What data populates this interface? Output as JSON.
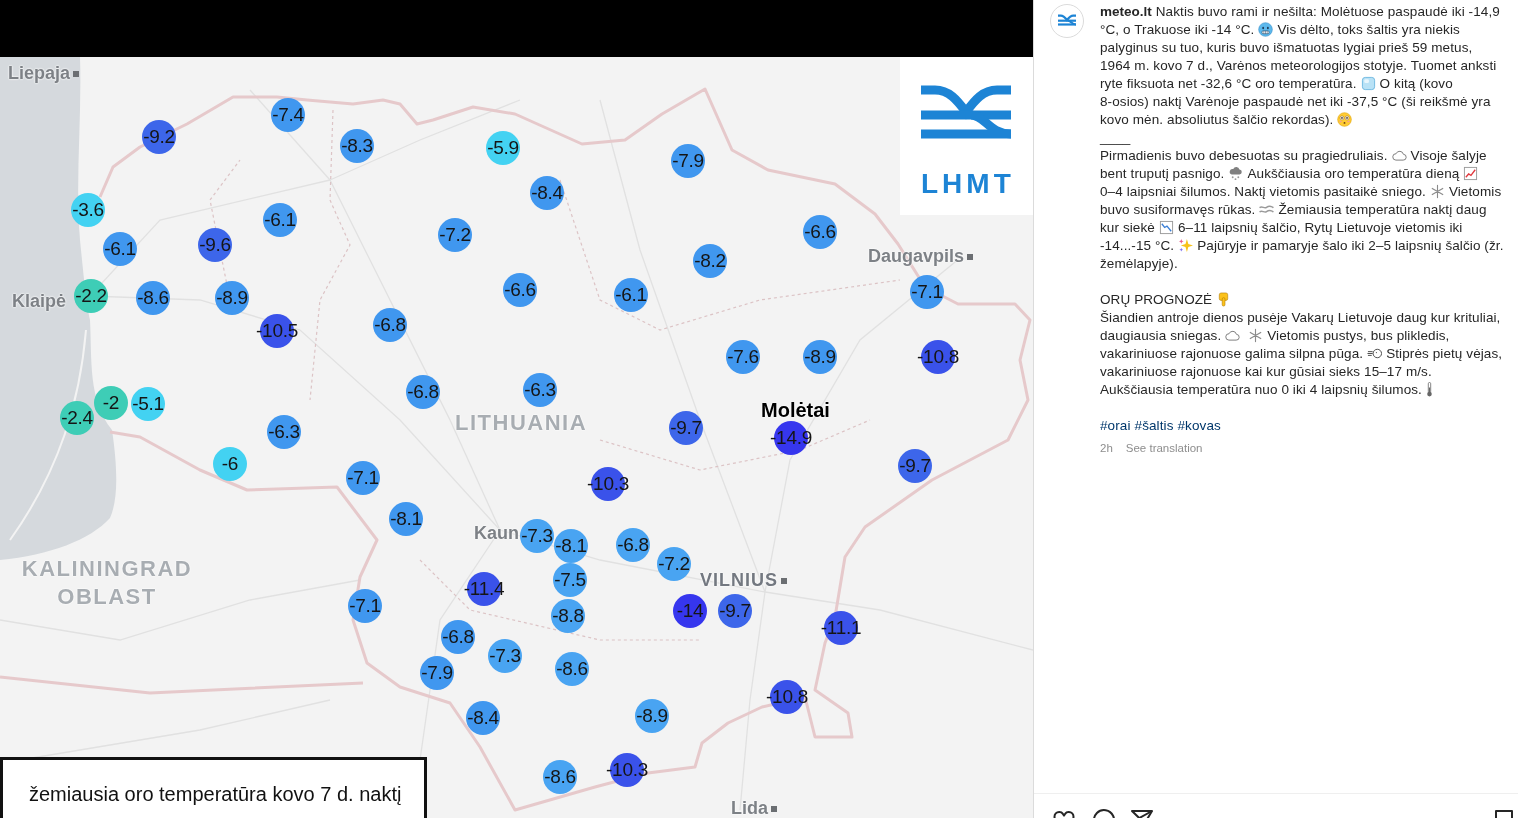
{
  "image": {
    "logo": {
      "text": "LHMT"
    },
    "labels": [
      {
        "kind": "city",
        "text": "Liepaja",
        "square": true
      },
      {
        "kind": "city",
        "text": "Klaipė",
        "square": false
      },
      {
        "kind": "city",
        "text": "Daugavpils",
        "square": true
      },
      {
        "kind": "country",
        "text": "LITHUANIA",
        "square": false
      },
      {
        "kind": "town",
        "text": "Molėtai",
        "square": false
      },
      {
        "kind": "country",
        "text": "KALININGRAD OBLAST",
        "square": false
      },
      {
        "kind": "city",
        "text": "Kaun",
        "square": false
      },
      {
        "kind": "capital",
        "text": "VILNIUS",
        "square": true
      },
      {
        "kind": "city",
        "text": "Lida",
        "square": true
      }
    ],
    "markers": [
      {
        "value": "-7.4",
        "color": "#4097ef"
      },
      {
        "value": "-9.2",
        "color": "#3d66ea"
      },
      {
        "value": "-8.3",
        "color": "#4097ef"
      },
      {
        "value": "-5.9",
        "color": "#43d2f2"
      },
      {
        "value": "-7.9",
        "color": "#4097ef"
      },
      {
        "value": "-8.4",
        "color": "#4097ef"
      },
      {
        "value": "-3.6",
        "color": "#43d2f2"
      },
      {
        "value": "-6.1",
        "color": "#4097ef"
      },
      {
        "value": "-9.6",
        "color": "#3d66ea"
      },
      {
        "value": "-6.1",
        "color": "#4097ef"
      },
      {
        "value": "-7.2",
        "color": "#4097ef"
      },
      {
        "value": "-6.6",
        "color": "#4097ef"
      },
      {
        "value": "-8.2",
        "color": "#4097ef"
      },
      {
        "value": "-2.2",
        "color": "#3ecdb6"
      },
      {
        "value": "-8.6",
        "color": "#4097ef"
      },
      {
        "value": "-8.9",
        "color": "#4097ef"
      },
      {
        "value": "-6.6",
        "color": "#4097ef"
      },
      {
        "value": "-6.1",
        "color": "#4097ef"
      },
      {
        "value": "-7.1",
        "color": "#4097ef"
      },
      {
        "value": "-10.5",
        "color": "#3a52ea"
      },
      {
        "value": "-6.8",
        "color": "#4097ef"
      },
      {
        "value": "-7.6",
        "color": "#4097ef"
      },
      {
        "value": "-8.9",
        "color": "#4097ef"
      },
      {
        "value": "-10.8",
        "color": "#3a52ea"
      },
      {
        "value": "-6.8",
        "color": "#4097ef"
      },
      {
        "value": "-6.3",
        "color": "#4097ef"
      },
      {
        "value": "-2.4",
        "color": "#3ecdb6"
      },
      {
        "value": "-2",
        "color": "#3ecdb6"
      },
      {
        "value": "-5.1",
        "color": "#43d2f2"
      },
      {
        "value": "-6.3",
        "color": "#4097ef"
      },
      {
        "value": "-9.7",
        "color": "#3d66ea"
      },
      {
        "value": "-14.9",
        "color": "#3636ee"
      },
      {
        "value": "-9.7",
        "color": "#3d66ea"
      },
      {
        "value": "-6",
        "color": "#43d2f2"
      },
      {
        "value": "-7.1",
        "color": "#4097ef"
      },
      {
        "value": "-10.3",
        "color": "#3a52ea"
      },
      {
        "value": "-8.1",
        "color": "#4097ef"
      },
      {
        "value": "-7.3",
        "color": "#49a4f2"
      },
      {
        "value": "-8.1",
        "color": "#49a4f2"
      },
      {
        "value": "-6.8",
        "color": "#49a4f2"
      },
      {
        "value": "-7.2",
        "color": "#49a4f2"
      },
      {
        "value": "-7.5",
        "color": "#49a4f2"
      },
      {
        "value": "-11.4",
        "color": "#3a52ea"
      },
      {
        "value": "-7.1",
        "color": "#4097ef"
      },
      {
        "value": "-8.8",
        "color": "#49a4f2"
      },
      {
        "value": "-14",
        "color": "#3636ee"
      },
      {
        "value": "-9.7",
        "color": "#3d66ea"
      },
      {
        "value": "-11.1",
        "color": "#3a52ea"
      },
      {
        "value": "-6.8",
        "color": "#4097ef"
      },
      {
        "value": "-7.3",
        "color": "#49a4f2"
      },
      {
        "value": "-7.9",
        "color": "#4097ef"
      },
      {
        "value": "-8.6",
        "color": "#49a4f2"
      },
      {
        "value": "-10.8",
        "color": "#3a52ea"
      },
      {
        "value": "-8.4",
        "color": "#4097ef"
      },
      {
        "value": "-8.9",
        "color": "#49a4f2"
      },
      {
        "value": "-8.6",
        "color": "#49a4f2"
      },
      {
        "value": "-10.3",
        "color": "#3a52ea"
      }
    ],
    "caption": "žemiausia oro temperatūra kovo 7 d. naktį"
  },
  "post": {
    "username": "meteo.lt",
    "paragraphs": [
      {
        "lines": [
          {
            "segments": [
              {
                "kind": "text",
                "text": "Naktis buvo rami ir nešilta: Molėtuose paspaudė iki -14,9"
              }
            ]
          },
          {
            "segments": [
              {
                "kind": "text",
                "text": "°C, o Trakuose iki -14 °C."
              },
              {
                "kind": "emoji"
              },
              {
                "kind": "text",
                "text": "Vis dėlto, toks šaltis yra niekis"
              }
            ]
          },
          {
            "segments": [
              {
                "kind": "text",
                "text": "palyginus su tuo, kuris buvo išmatuotas lygiai prieš 59 metus,"
              }
            ]
          },
          {
            "segments": [
              {
                "kind": "text",
                "text": "1964 m. kovo 7 d., Varėnos meteorologijos stotyje. Tuomet anksti"
              }
            ]
          },
          {
            "segments": [
              {
                "kind": "text",
                "text": "ryte fiksuota net -32,6 °C oro temperatūra."
              },
              {
                "kind": "emoji"
              },
              {
                "kind": "text",
                "text": "O kitą (kovo"
              }
            ]
          },
          {
            "segments": [
              {
                "kind": "text",
                "text": "8-osios) naktį Varėnoje paspaudė net iki -37,5 °C (ši reikšmė yra"
              }
            ]
          },
          {
            "segments": [
              {
                "kind": "text",
                "text": "kovo mėn. absoliutus šalčio rekordas)."
              },
              {
                "kind": "emoji"
              }
            ]
          },
          {
            "segments": [
              {
                "kind": "text",
                "text": "____"
              }
            ]
          },
          {
            "segments": [
              {
                "kind": "text",
                "text": "Pirmadienis buvo debesuotas su pragiedruliais."
              },
              {
                "kind": "emoji"
              },
              {
                "kind": "text",
                "text": "Visoje šalyje"
              }
            ]
          },
          {
            "segments": [
              {
                "kind": "text",
                "text": "bent truputį pasnigo."
              },
              {
                "kind": "emoji"
              },
              {
                "kind": "text",
                "text": "Aukščiausia oro temperatūra dieną"
              },
              {
                "kind": "emoji"
              }
            ]
          },
          {
            "segments": [
              {
                "kind": "text",
                "text": "0–4 laipsniai šilumos. Naktį vietomis pasitaikė sniego."
              },
              {
                "kind": "emoji"
              },
              {
                "kind": "text",
                "text": "Vietomis"
              }
            ]
          },
          {
            "segments": [
              {
                "kind": "text",
                "text": "buvo susiformavęs rūkas."
              },
              {
                "kind": "emoji"
              },
              {
                "kind": "text",
                "text": "Žemiausia temperatūra naktį daug"
              }
            ]
          },
          {
            "segments": [
              {
                "kind": "text",
                "text": "kur siekė"
              },
              {
                "kind": "emoji"
              },
              {
                "kind": "text",
                "text": "6–11 laipsnių šalčio, Rytų Lietuvoje vietomis iki"
              }
            ]
          },
          {
            "segments": [
              {
                "kind": "text",
                "text": "-14...-15 °C."
              },
              {
                "kind": "emoji"
              },
              {
                "kind": "text",
                "text": "Pajūryje ir pamaryje šalo iki 2–5 laipsnių šalčio (žr."
              }
            ]
          },
          {
            "segments": [
              {
                "kind": "text",
                "text": "žemėlapyje)."
              }
            ]
          }
        ]
      },
      {
        "lines": [
          {
            "segments": [
              {
                "kind": "text",
                "text": "ORŲ PROGNOZĖ"
              },
              {
                "kind": "emoji"
              }
            ]
          },
          {
            "segments": [
              {
                "kind": "text",
                "text": "Šiandien antroje dienos pusėje Vakarų Lietuvoje daug kur krituliai,"
              }
            ]
          },
          {
            "segments": [
              {
                "kind": "text",
                "text": "daugiausia sniegas."
              },
              {
                "kind": "emoji"
              },
              {
                "kind": "emoji"
              },
              {
                "kind": "text",
                "text": "Vietomis pustys, bus plikledis,"
              }
            ]
          },
          {
            "segments": [
              {
                "kind": "text",
                "text": "vakariniuose rajonuose galima silpna pūga."
              },
              {
                "kind": "emoji"
              },
              {
                "kind": "text",
                "text": "Stiprės pietų vėjas,"
              }
            ]
          },
          {
            "segments": [
              {
                "kind": "text",
                "text": "vakariniuose rajonuose kai kur gūsiai sieks 15–17 m/s."
              }
            ]
          },
          {
            "segments": [
              {
                "kind": "text",
                "text": "Aukščiausia temperatūra nuo 0 iki 4 laipsnių šilumos."
              },
              {
                "kind": "emoji"
              }
            ]
          }
        ]
      }
    ],
    "hashtags": [
      "#orai",
      "#šaltis",
      "#kovas"
    ],
    "time": "2h",
    "translate": "See translation"
  }
}
